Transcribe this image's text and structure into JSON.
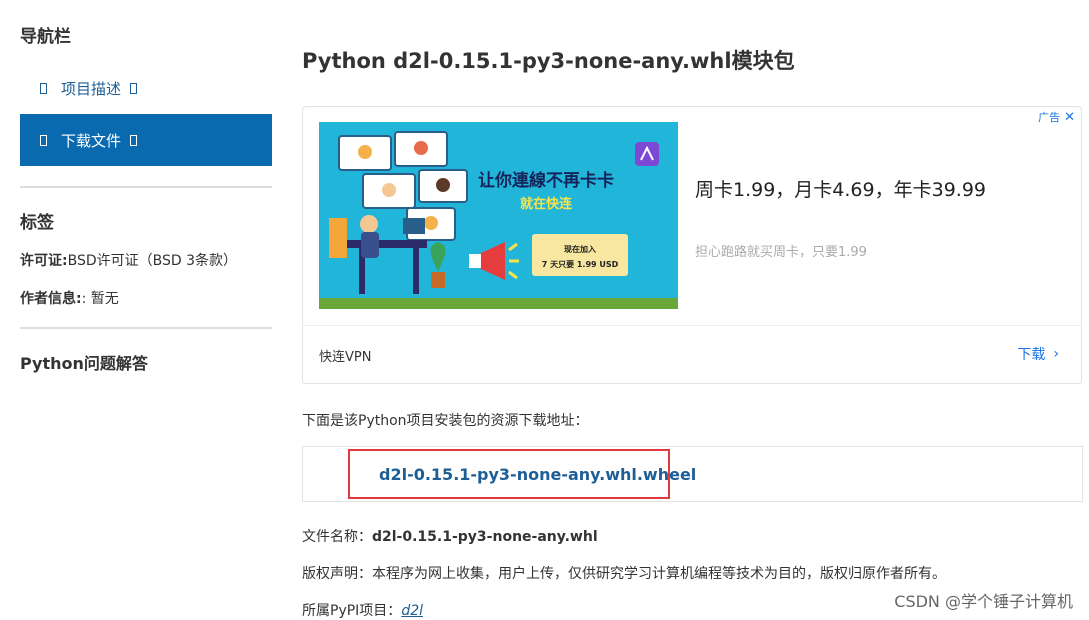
{
  "sidebar": {
    "title": "导航栏",
    "items": [
      {
        "label": "项目描述",
        "active": false
      },
      {
        "label": "下载文件",
        "active": true
      }
    ],
    "tags_title": "标签",
    "tags": [
      {
        "key": "许可证:",
        "value": "BSD许可证（BSD 3条款）"
      },
      {
        "key": "作者信息:",
        "value": ": 暂无"
      }
    ],
    "qa_title": "Python问题解答"
  },
  "main": {
    "title": "Python d2l-0.15.1-py3-none-any.whl模块包",
    "ad": {
      "badge": "广告",
      "image_title": "让你連線不再卡卡",
      "image_subtitle": "就在快连",
      "image_promo_line1": "现在加入",
      "image_promo_line2": "7 天只要 1.99 USD",
      "headline": "周卡1.99，月卡4.69，年卡39.99",
      "subtext": "担心跑路就买周卡，只要1.99",
      "brand": "快连VPN",
      "cta": "下载"
    },
    "intro": "下面是该Python项目安装包的资源下载地址：",
    "download_link": "d2l-0.15.1-py3-none-any.whl.wheel",
    "file_name_label": "文件名称：",
    "file_name": "d2l-0.15.1-py3-none-any.whl",
    "copyright_label": "版权声明：",
    "copyright": "本程序为网上收集，用户上传，仅供研究学习计算机编程等技术为目的，版权归原作者所有。",
    "pypi_label": "所属PyPI项目：",
    "pypi_link": "d2l"
  },
  "watermark": "CSDN @学个锤子计算机",
  "colors": {
    "accent": "#0a6ab0",
    "link": "#1d5e95",
    "highlight_border": "#e0393e",
    "ad_bg": "#24b6d9"
  }
}
